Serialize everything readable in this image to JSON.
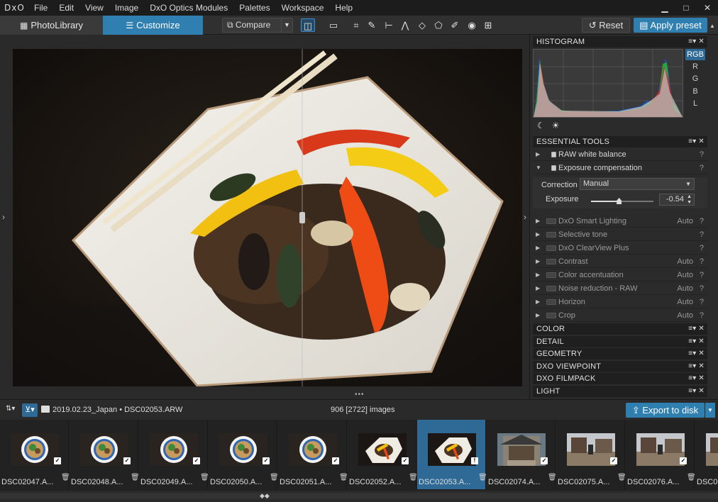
{
  "menubar": {
    "logo": "DxO",
    "items": [
      "File",
      "Edit",
      "View",
      "Image",
      "DxO Optics Modules",
      "Palettes",
      "Workspace",
      "Help"
    ],
    "win_min": "▁",
    "win_max": "□",
    "win_close": "✕"
  },
  "toolbar": {
    "tab_library": "PhotoLibrary",
    "tab_customize": "Customize",
    "compare": "Compare",
    "reset": "Reset",
    "apply_preset": "Apply preset"
  },
  "histogram": {
    "title": "HISTOGRAM",
    "channels": [
      "RGB",
      "R",
      "G",
      "B",
      "L"
    ],
    "active_channel": "RGB"
  },
  "essential_tools": {
    "title": "ESSENTIAL TOOLS",
    "raw_white_balance": "RAW white balance",
    "exposure_compensation": "Exposure compensation",
    "correction_label": "Correction",
    "correction_value": "Manual",
    "exposure_label": "Exposure",
    "exposure_value": "-0.54",
    "exposure_fraction": 0.45,
    "tools": [
      {
        "label": "DxO Smart Lighting",
        "auto": "Auto"
      },
      {
        "label": "Selective tone",
        "auto": ""
      },
      {
        "label": "DxO ClearView Plus",
        "auto": ""
      },
      {
        "label": "Contrast",
        "auto": "Auto"
      },
      {
        "label": "Color accentuation",
        "auto": "Auto"
      },
      {
        "label": "Noise reduction - RAW",
        "auto": "Auto"
      },
      {
        "label": "Horizon",
        "auto": "Auto"
      },
      {
        "label": "Crop",
        "auto": "Auto"
      }
    ],
    "help": "?"
  },
  "sections": [
    "COLOR",
    "DETAIL",
    "GEOMETRY",
    "DXO VIEWPOINT",
    "DXO FILMPACK",
    "LIGHT"
  ],
  "panel_controls": "≡▾ ✕",
  "browser": {
    "path": "2019.02.23_Japan • DSC02053.ARW",
    "count": "906 [2722] images",
    "export": "Export to disk"
  },
  "filmstrip": [
    {
      "name": "DSC02047.A...",
      "kind": "bowl"
    },
    {
      "name": "DSC02048.A...",
      "kind": "bowl"
    },
    {
      "name": "DSC02049.A...",
      "kind": "bowl"
    },
    {
      "name": "DSC02050.A...",
      "kind": "bowl"
    },
    {
      "name": "DSC02051.A...",
      "kind": "bowl"
    },
    {
      "name": "DSC02052.A...",
      "kind": "plate"
    },
    {
      "name": "DSC02053.A...",
      "kind": "plate",
      "selected": true
    },
    {
      "name": "DSC02074.A...",
      "kind": "temple"
    },
    {
      "name": "DSC02075.A...",
      "kind": "street"
    },
    {
      "name": "DSC02076.A...",
      "kind": "street"
    },
    {
      "name": "DSC0...",
      "kind": "street"
    }
  ],
  "colors": {
    "accent": "#2f7fb0",
    "panel_head": "#1f1f1f"
  }
}
